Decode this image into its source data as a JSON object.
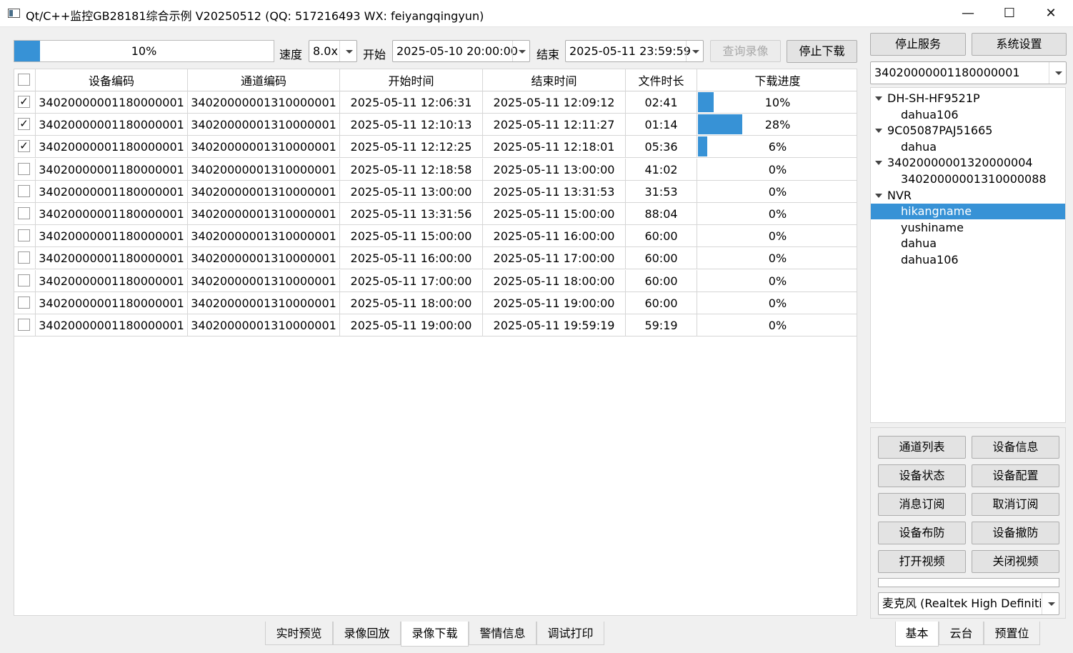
{
  "window": {
    "title": "Qt/C++监控GB28181综合示例 V20250512 (QQ: 517216493 WX: feiyangqingyun)",
    "minimize": "—",
    "maximize": "☐",
    "close": "✕"
  },
  "toolbar": {
    "progress_value": 10,
    "progress_text": "10%",
    "speed_label": "速度",
    "speed_value": "8.0x",
    "start_label": "开始",
    "start_value": "2025-05-10 20:00:00",
    "end_label": "结束",
    "end_value": "2025-05-11 23:59:59",
    "query_button": "查询录像",
    "stop_download_button": "停止下载"
  },
  "table": {
    "headers": [
      "设备编码",
      "通道编码",
      "开始时间",
      "结束时间",
      "文件时长",
      "下载进度"
    ],
    "rows": [
      {
        "checked": true,
        "device": "34020000001180000001",
        "channel": "34020000001310000001",
        "start": "2025-05-11 12:06:31",
        "end": "2025-05-11 12:09:12",
        "duration": "02:41",
        "progress": 10,
        "progress_text": "10%"
      },
      {
        "checked": true,
        "device": "34020000001180000001",
        "channel": "34020000001310000001",
        "start": "2025-05-11 12:10:13",
        "end": "2025-05-11 12:11:27",
        "duration": "01:14",
        "progress": 28,
        "progress_text": "28%"
      },
      {
        "checked": true,
        "device": "34020000001180000001",
        "channel": "34020000001310000001",
        "start": "2025-05-11 12:12:25",
        "end": "2025-05-11 12:18:01",
        "duration": "05:36",
        "progress": 6,
        "progress_text": "6%"
      },
      {
        "checked": false,
        "device": "34020000001180000001",
        "channel": "34020000001310000001",
        "start": "2025-05-11 12:18:58",
        "end": "2025-05-11 13:00:00",
        "duration": "41:02",
        "progress": 0,
        "progress_text": "0%"
      },
      {
        "checked": false,
        "device": "34020000001180000001",
        "channel": "34020000001310000001",
        "start": "2025-05-11 13:00:00",
        "end": "2025-05-11 13:31:53",
        "duration": "31:53",
        "progress": 0,
        "progress_text": "0%"
      },
      {
        "checked": false,
        "device": "34020000001180000001",
        "channel": "34020000001310000001",
        "start": "2025-05-11 13:31:56",
        "end": "2025-05-11 15:00:00",
        "duration": "88:04",
        "progress": 0,
        "progress_text": "0%"
      },
      {
        "checked": false,
        "device": "34020000001180000001",
        "channel": "34020000001310000001",
        "start": "2025-05-11 15:00:00",
        "end": "2025-05-11 16:00:00",
        "duration": "60:00",
        "progress": 0,
        "progress_text": "0%"
      },
      {
        "checked": false,
        "device": "34020000001180000001",
        "channel": "34020000001310000001",
        "start": "2025-05-11 16:00:00",
        "end": "2025-05-11 17:00:00",
        "duration": "60:00",
        "progress": 0,
        "progress_text": "0%"
      },
      {
        "checked": false,
        "device": "34020000001180000001",
        "channel": "34020000001310000001",
        "start": "2025-05-11 17:00:00",
        "end": "2025-05-11 18:00:00",
        "duration": "60:00",
        "progress": 0,
        "progress_text": "0%"
      },
      {
        "checked": false,
        "device": "34020000001180000001",
        "channel": "34020000001310000001",
        "start": "2025-05-11 18:00:00",
        "end": "2025-05-11 19:00:00",
        "duration": "60:00",
        "progress": 0,
        "progress_text": "0%"
      },
      {
        "checked": false,
        "device": "34020000001180000001",
        "channel": "34020000001310000001",
        "start": "2025-05-11 19:00:00",
        "end": "2025-05-11 19:59:19",
        "duration": "59:19",
        "progress": 0,
        "progress_text": "0%"
      }
    ]
  },
  "bottom_tabs": [
    "实时预览",
    "录像回放",
    "录像下载",
    "警情信息",
    "调试打印"
  ],
  "active_bottom_tab": "录像下载",
  "right": {
    "stop_service_button": "停止服务",
    "settings_button": "系统设置",
    "device_select_value": "34020000001180000001",
    "tree": [
      {
        "label": "DH-SH-HF9521P",
        "level": 0,
        "expanded": true
      },
      {
        "label": "dahua106",
        "level": 1
      },
      {
        "label": "9C05087PAJ51665",
        "level": 0,
        "expanded": true
      },
      {
        "label": "dahua",
        "level": 1
      },
      {
        "label": "34020000001320000004",
        "level": 0,
        "expanded": true
      },
      {
        "label": "34020000001310000088",
        "level": 1
      },
      {
        "label": "NVR",
        "level": 0,
        "expanded": true
      },
      {
        "label": "hikangname",
        "level": 1,
        "selected": true
      },
      {
        "label": "yushiname",
        "level": 1
      },
      {
        "label": "dahua",
        "level": 1
      },
      {
        "label": "dahua106",
        "level": 1
      }
    ],
    "action_buttons": [
      "通道列表",
      "设备信息",
      "设备状态",
      "设备配置",
      "消息订阅",
      "取消订阅",
      "设备布防",
      "设备撤防",
      "打开视频",
      "关闭视频"
    ],
    "audio_device_value": "麦克风 (Realtek High Definiti",
    "tabs": [
      "基本",
      "云台",
      "预置位"
    ],
    "active_tab": "基本"
  },
  "colors": {
    "accent": "#3792d6",
    "window_bg": "#f0f0f0"
  }
}
